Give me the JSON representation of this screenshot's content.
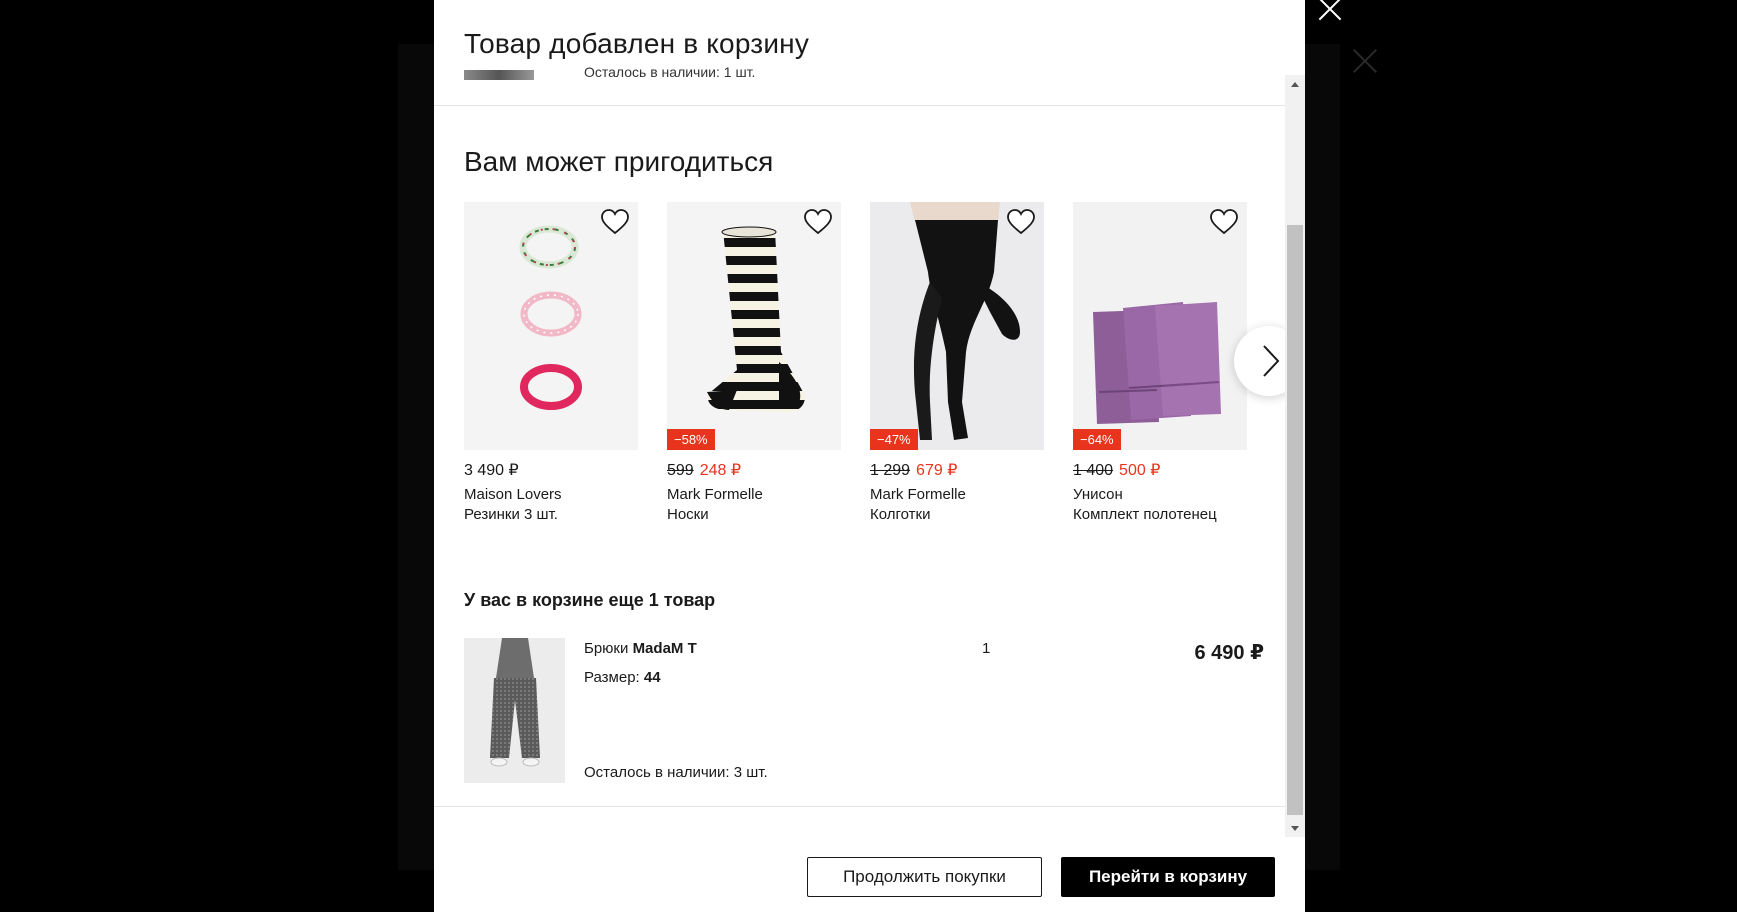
{
  "modal": {
    "title": "Товар добавлен в корзину",
    "peek_text": "Осталось в наличии: 1 шт."
  },
  "recommendations": {
    "title": "Вам может пригодиться",
    "items": [
      {
        "price": "3 490 ₽",
        "old_price": "",
        "new_price": "",
        "discount": "",
        "brand": "Maison Lovers",
        "type": "Резинки 3 шт."
      },
      {
        "price": "",
        "old_price": "599",
        "new_price": "248 ₽",
        "discount": "−58%",
        "brand": "Mark Formelle",
        "type": "Носки"
      },
      {
        "price": "",
        "old_price": "1 299",
        "new_price": "679 ₽",
        "discount": "−47%",
        "brand": "Mark Formelle",
        "type": "Колготки"
      },
      {
        "price": "",
        "old_price": "1 400",
        "new_price": "500 ₽",
        "discount": "−64%",
        "brand": "Унисон",
        "type": "Комплект полотенец"
      }
    ]
  },
  "cart": {
    "title": "У вас в корзине еще 1 товар",
    "item": {
      "type": "Брюки",
      "brand": "MadaM T",
      "size_label": "Размер:",
      "size": "44",
      "stock": "Осталось в наличии: 3 шт.",
      "qty": "1",
      "price": "6 490 ₽"
    }
  },
  "footer": {
    "continue_label": "Продолжить покупки",
    "cart_label": "Перейти в корзину"
  },
  "colors": {
    "discount": "#e8341c",
    "primary": "#000000"
  }
}
